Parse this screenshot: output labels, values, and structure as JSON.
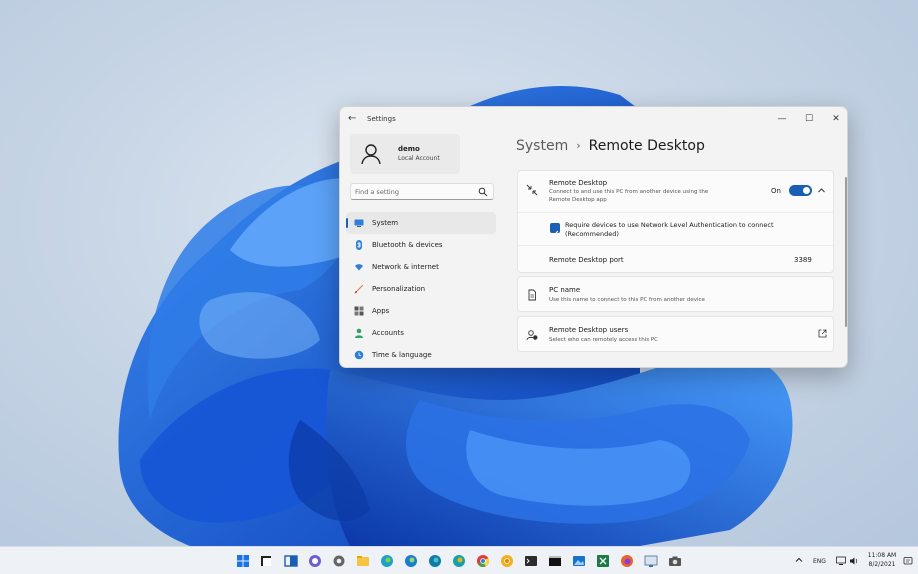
{
  "window": {
    "title": "Settings",
    "back": "←",
    "minimize": "—",
    "maximize": "☐",
    "close": "✕"
  },
  "profile": {
    "name": "demo",
    "account_type": "Local Account"
  },
  "search": {
    "placeholder": "Find a setting"
  },
  "nav": {
    "items": [
      {
        "label": "System",
        "icon": "monitor-icon",
        "active": true
      },
      {
        "label": "Bluetooth & devices",
        "icon": "bluetooth-icon"
      },
      {
        "label": "Network & internet",
        "icon": "wifi-icon"
      },
      {
        "label": "Personalization",
        "icon": "brush-icon"
      },
      {
        "label": "Apps",
        "icon": "apps-icon"
      },
      {
        "label": "Accounts",
        "icon": "person-icon"
      },
      {
        "label": "Time & language",
        "icon": "globe-clock-icon"
      }
    ]
  },
  "breadcrumb": {
    "parent": "System",
    "separator": "›",
    "current": "Remote Desktop"
  },
  "remote_desktop": {
    "title": "Remote Desktop",
    "description": "Connect to and use this PC from another device using the Remote Desktop app",
    "toggle_label": "On",
    "toggle_on": true,
    "nla_label": "Require devices to use Network Level Authentication to connect (Recommended)",
    "nla_checked": true,
    "port_label": "Remote Desktop port",
    "port_value": "3389"
  },
  "pc_name": {
    "title": "PC name",
    "description": "Use this name to connect to this PC from another device"
  },
  "remote_users": {
    "title": "Remote Desktop users",
    "description": "Select who can remotely access this PC"
  },
  "taskbar": {
    "language": "ENG",
    "time": "11:08 AM",
    "date": "8/2/2021"
  },
  "colors": {
    "accent": "#1a5fb4",
    "window_bg": "#f3f3f3",
    "card_bg": "#fbfbfb",
    "taskbar_bg": "#eef1f6"
  }
}
